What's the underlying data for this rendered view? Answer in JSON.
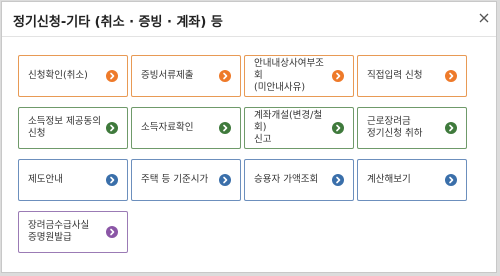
{
  "dialog": {
    "title": "정기신청-기타 (취소 · 증빙 · 계좌) 등",
    "close_icon": "close-icon"
  },
  "buttons": [
    {
      "label": "신청확인(취소)",
      "color": "orange"
    },
    {
      "label": "증빙서류제출",
      "color": "orange"
    },
    {
      "label": "안내내상사여부조회\n(미안내사유)",
      "color": "orange"
    },
    {
      "label": "직접입력 신청",
      "color": "orange"
    },
    {
      "label": "소득정보 제공동의\n신청",
      "color": "green"
    },
    {
      "label": "소득자료확인",
      "color": "green"
    },
    {
      "label": "계좌개설(변경/철회)\n신고",
      "color": "green"
    },
    {
      "label": "근로장려금\n정기신청 취하",
      "color": "green"
    },
    {
      "label": "제도안내",
      "color": "blue"
    },
    {
      "label": "주택 등 기준시가",
      "color": "blue"
    },
    {
      "label": "승용자 가액조회",
      "color": "blue"
    },
    {
      "label": "계산해보기",
      "color": "blue"
    },
    {
      "label": "장려금수급사실\n증명원발급",
      "color": "purple"
    }
  ],
  "colors": {
    "orange": "#ee7a2a",
    "green": "#3f7a3c",
    "blue": "#3a6faa",
    "purple": "#8b56a6"
  },
  "arrow_icon": "chevron-right-circle-icon"
}
